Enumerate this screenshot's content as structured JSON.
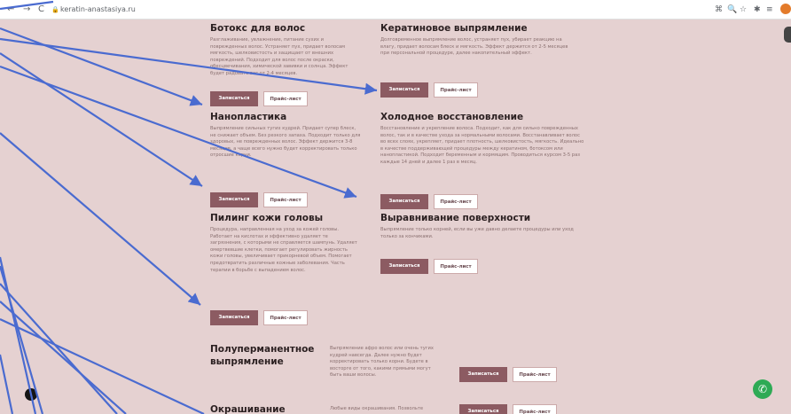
{
  "browser": {
    "back": "←",
    "forward": "→",
    "reload": "C",
    "lock": "🔒",
    "url": "keratin-anastasiya.ru",
    "toolbar_icons": [
      "⌘",
      "🔍",
      "☆",
      "✱",
      "≡"
    ]
  },
  "buttons": {
    "book": "Записаться",
    "price": "Прайс-лист"
  },
  "services": [
    {
      "title": "Ботокс для волос",
      "text": "Разглаживание, увлажнение, питание сухих и поврежденных волос. Устраняет пух, придает волосам мягкость, шелковистость и защищает от внешних повреждений. Подходит для волос после окраски, обесцвечивания, химической завивки и солнца. Эффект будет радовать вас от 2-4 месяцев."
    },
    {
      "title": "Кератиновое выпрямление",
      "text": "Долговременное выпрямление волос, устраняет пух, убирает реакцию на влагу, придает волосам блеск и мягкость. Эффект держится от 2-5 месяцев при персональной процедуре, далее накопительный эффект."
    },
    {
      "title": "Нанопластика",
      "text": "Выпрямление сильных тугих кудрей. Придает супер блеск, не снижает объем. Без резкого запаха. Подходит только для здоровых, не поврежденных волос. Эффект держится 3-8 месяцев, а чаще всего нужно будет корректировать только отросшие корни."
    },
    {
      "title": "Холодное восстановление",
      "text": "Восстановление и укрепление волоса. Подходит, как для сильно поврежденных волос, так и в качестве ухода за нормальными волосами. Восстанавливает волос во всех слоях, укрепляет, придает плотность, шелковистость, мягкость. Идеально в качестве поддерживающей процедуры между кератином, ботоксом или нанопластикой. Подходит беременным и кормящим. Проводиться курсом 3-5 раз каждые 14 дней и далее 1 раз в месяц."
    },
    {
      "title": "Пилинг кожи головы",
      "text": "Процедура, направленная на уход за кожей головы. Работает на кислотах и эффективно удаляет те загрязнения, с которыми не справляется шампунь. Удаляет омертвевшие клетки, помогает регулировать жирность кожи головы, увеличивает прикорневой объем. Помогает предотвратить различные кожные заболевания. Часть терапии в борьбе с выпадением волос."
    },
    {
      "title": "Выравнивание поверхности",
      "text": "Выпрямление только корней, если вы уже давно делаете процедуры или уход только за кончиками."
    },
    {
      "title": "Полуперманентное выпрямление",
      "text": "Выпрямление афро волос или очень тугих кудрей навсегда. Далее нужно будет корректировать только корни. Будете в восторге от того, какими прямыми могут быть ваши волосы."
    },
    {
      "title": "Окрашивание",
      "text": "Любые виды окрашивания. Позвольте"
    }
  ],
  "colors": {
    "background": "#e5d1d1",
    "accent": "#8c5b62",
    "arrow": "#4a6bd0",
    "phone": "#2eaa55"
  }
}
